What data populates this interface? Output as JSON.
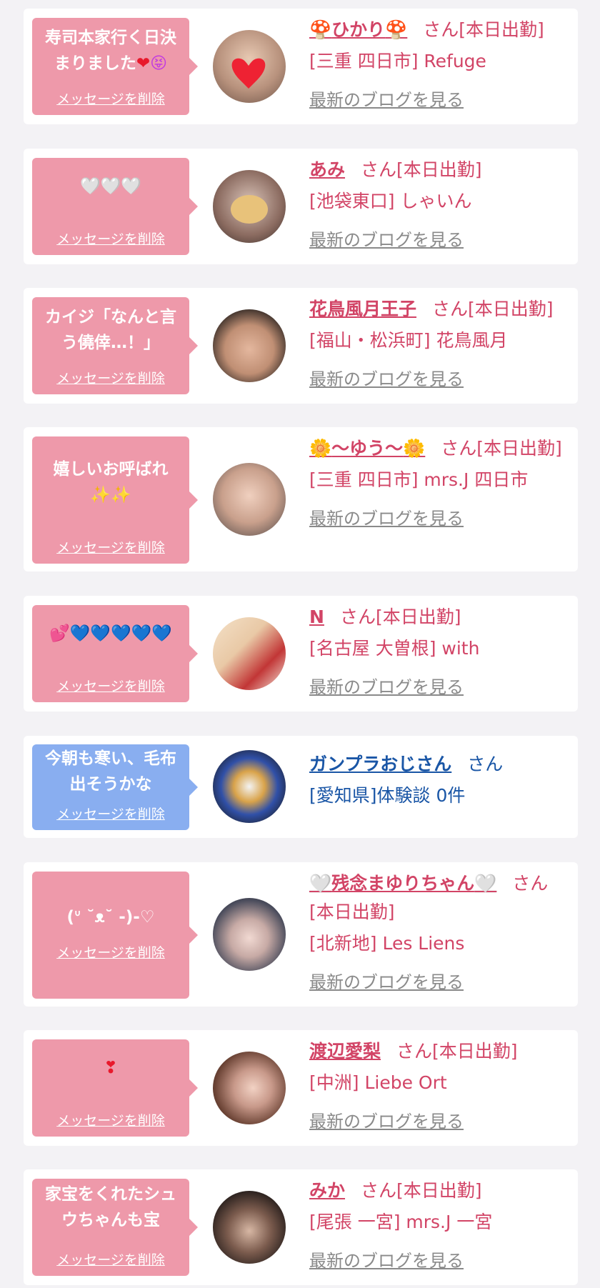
{
  "cards": [
    {
      "message_lines": [
        "寿司本家行く日決",
        "まりました"
      ],
      "message_emoji": [
        "❤",
        "😝"
      ],
      "delete_label": "メッセージを削除",
      "name": "ひかり",
      "name_icon": "mushroom-icon",
      "suffix": "さん[本日出勤]",
      "shop": "[三重 四日市] Refuge",
      "blog": "最新のブログを見る"
    },
    {
      "message_lines": [
        "🤍🤍🤍"
      ],
      "delete_label": "メッセージを削除",
      "name": "あみ",
      "suffix": "さん[本日出勤]",
      "shop": "[池袋東口] しゃいん",
      "blog": "最新のブログを見る"
    },
    {
      "message_lines": [
        "カイジ「なんと言",
        "う僥倖…！」"
      ],
      "delete_label": "メッセージを削除",
      "name": "花鳥風月王子",
      "suffix": "さん[本日出勤]",
      "shop": "[福山・松浜町] 花鳥風月",
      "blog": "最新のブログを見る"
    },
    {
      "message_lines": [
        "嬉しいお呼ばれ",
        "✨✨"
      ],
      "delete_label": "メッセージを削除",
      "name": "〜ゆう〜",
      "name_icon": "sun-flower-icon",
      "suffix": "さん[本日出勤]",
      "shop": "[三重 四日市] mrs.J 四日市",
      "blog": "最新のブログを見る"
    },
    {
      "message_lines": [
        "💕💙💙💙💙💙"
      ],
      "delete_label": "メッセージを削除",
      "name": "N",
      "suffix": "さん[本日出勤]",
      "shop": "[名古屋 大曽根] with",
      "blog": "最新のブログを見る"
    },
    {
      "message_lines": [
        "今朝も寒い、毛布",
        "出そうかな"
      ],
      "delete_label": "メッセージを削除",
      "name": "ガンプラおじさん",
      "suffix": "さん",
      "shop": "[愛知県]体験談 0件",
      "blog": ""
    },
    {
      "message_lines": [
        "(ᐡ ˘ᴥ˘ -)-♡"
      ],
      "delete_label": "メッセージを削除",
      "name": "残念まゆりちゃん",
      "name_icon": "white-heart-icon",
      "suffix": "さん[本日出勤]",
      "shop": "[北新地] Les Liens",
      "blog": "最新のブログを見る"
    },
    {
      "message_lines": [
        "❣"
      ],
      "delete_label": "メッセージを削除",
      "name": "渡辺愛梨",
      "suffix": "さん[本日出勤]",
      "shop": "[中洲] Liebe Ort",
      "blog": "最新のブログを見る"
    },
    {
      "message_lines": [
        "家宝をくれたシュ",
        "ウちゃんも宝"
      ],
      "delete_label": "メッセージを削除",
      "name": "みか",
      "suffix": "さん[本日出勤]",
      "shop": "[尾張 一宮] mrs.J 一宮",
      "blog": "最新のブログを見る"
    }
  ]
}
